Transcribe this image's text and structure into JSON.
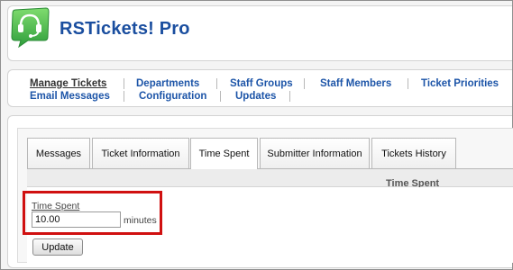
{
  "app": {
    "title": "RSTickets! Pro",
    "logo_icon": "headset-icon",
    "brand_color": "#1a4e9f",
    "logo_color": "#3bb54a"
  },
  "menu": {
    "items": [
      {
        "label": "Manage Tickets",
        "active": true
      },
      {
        "label": "Departments"
      },
      {
        "label": "Staff Groups"
      },
      {
        "label": "Staff Members"
      },
      {
        "label": "Ticket Priorities"
      },
      {
        "label": "Email Messages"
      },
      {
        "label": "Configuration"
      },
      {
        "label": "Updates"
      }
    ]
  },
  "tabs": [
    {
      "label": "Messages"
    },
    {
      "label": "Ticket Information"
    },
    {
      "label": "Time Spent",
      "active": true
    },
    {
      "label": "Submitter Information"
    },
    {
      "label": "Tickets History"
    }
  ],
  "panel": {
    "header": "Time Spent"
  },
  "form": {
    "time_spent_label": "Time Spent",
    "time_spent_value": "10.00",
    "unit": "minutes",
    "update_label": "Update"
  },
  "highlight_color": "#d01010"
}
